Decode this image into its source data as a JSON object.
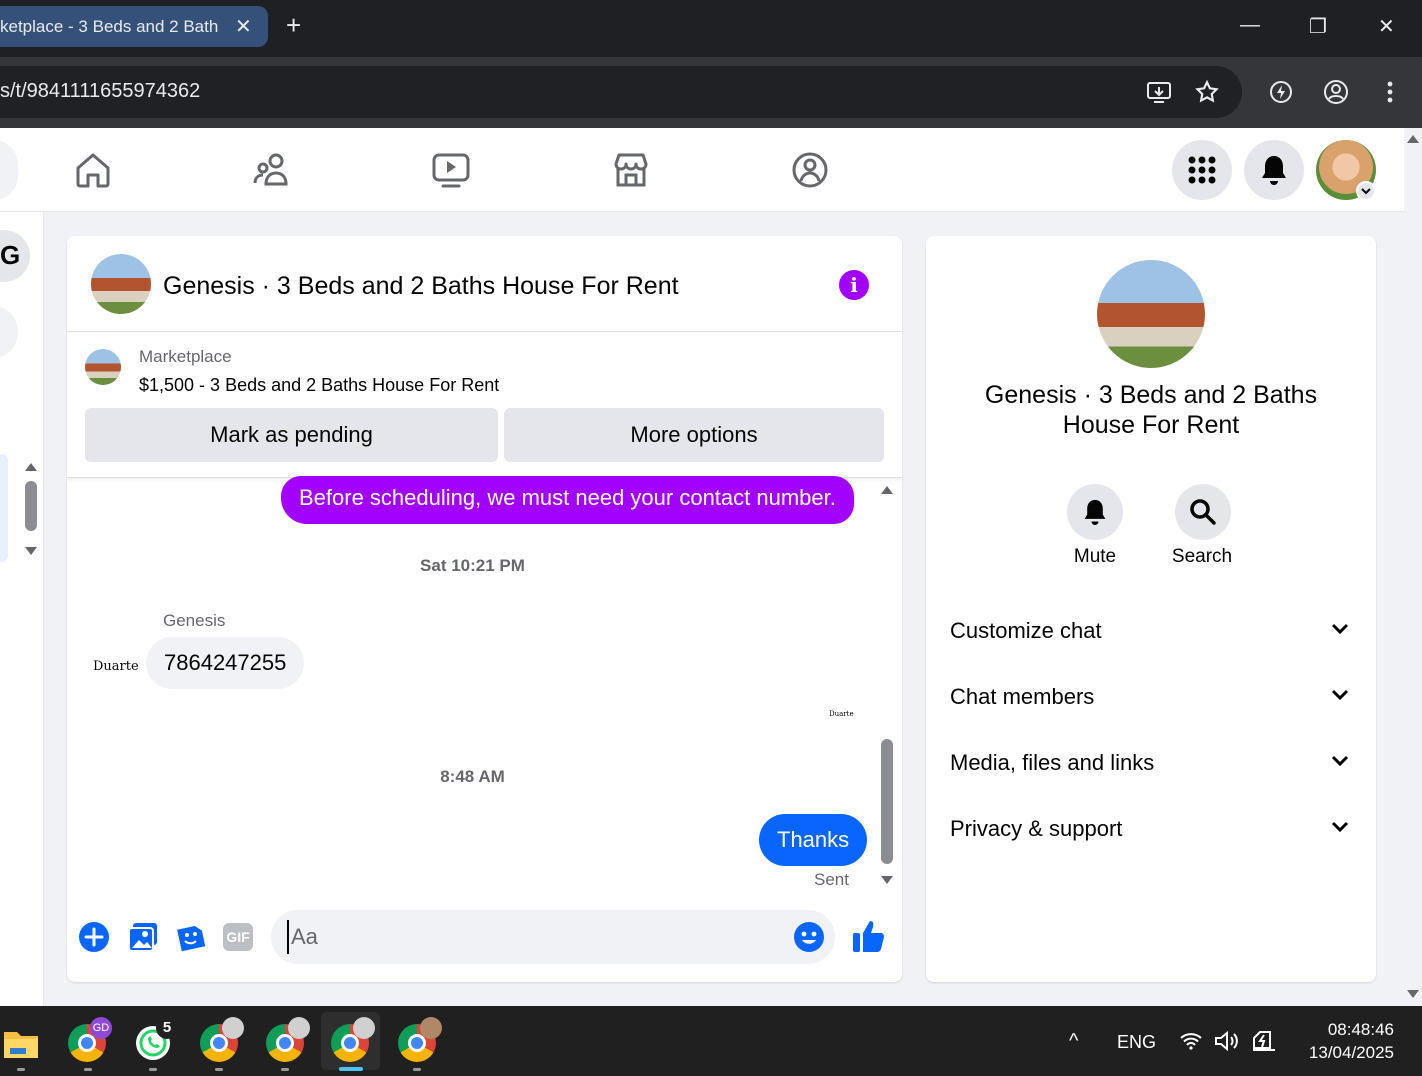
{
  "browser": {
    "tab_title": "ketplace - 3 Beds and 2 Bath",
    "tab_close": "✕",
    "new_tab": "+",
    "url": "s/t/9841111655974362",
    "minimize": "—",
    "maximize": "❐",
    "close": "✕"
  },
  "fbnav": {
    "icons": [
      "home-icon",
      "friends-icon",
      "video-icon",
      "marketplace-icon",
      "groups-icon"
    ],
    "right_icons": [
      "menu-grid-icon",
      "notifications-bell-icon"
    ]
  },
  "chat": {
    "title": "Genesis · 3 Beds and 2 Baths House For Rent",
    "info_glyph": "i",
    "marketplace": {
      "label": "Marketplace",
      "listing": "$1,500 - 3 Beds and 2 Baths House For Rent",
      "mark_pending": "Mark as pending",
      "more_options": "More options"
    },
    "messages": {
      "sent_1": "Before scheduling, we must need your contact number.",
      "timestamp_1": "Sat 10:21 PM",
      "sender_name": "Genesis",
      "avatar_text": "Duarte",
      "received_1": "7864247255",
      "read_receipt_text": "Duarte",
      "timestamp_2": "8:48 AM",
      "sent_2": "Thanks",
      "status": "Sent"
    },
    "composer": {
      "placeholder": "Aa",
      "gif_label": "GIF"
    }
  },
  "info_panel": {
    "name": "Genesis · 3 Beds and 2 Baths House For Rent",
    "mute": "Mute",
    "search": "Search",
    "rows": [
      "Customize chat",
      "Chat members",
      "Media, files and links",
      "Privacy & support"
    ]
  },
  "taskbar": {
    "badge_gd": "GD",
    "badge_whatsapp": "5",
    "tray_chevron": "^",
    "language": "ENG",
    "time": "08:48:46",
    "date": "13/04/2025"
  },
  "colors": {
    "messenger_purple": "#a200ff",
    "messenger_blue": "#0866ff",
    "fb_blue": "#0866ff"
  }
}
